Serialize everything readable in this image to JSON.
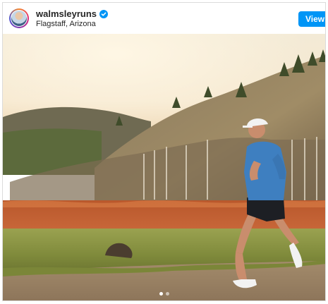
{
  "post": {
    "username": "walmsleyruns",
    "location": "Flagstaff, Arizona",
    "view_button_label": "View P",
    "carousel": {
      "slide_count": 2,
      "active_index": 0
    }
  },
  "icons": {
    "verified": "verified-badge-icon"
  },
  "colors": {
    "accent": "#0095f6",
    "username_text": "#262626",
    "border": "#dbdbdb"
  }
}
